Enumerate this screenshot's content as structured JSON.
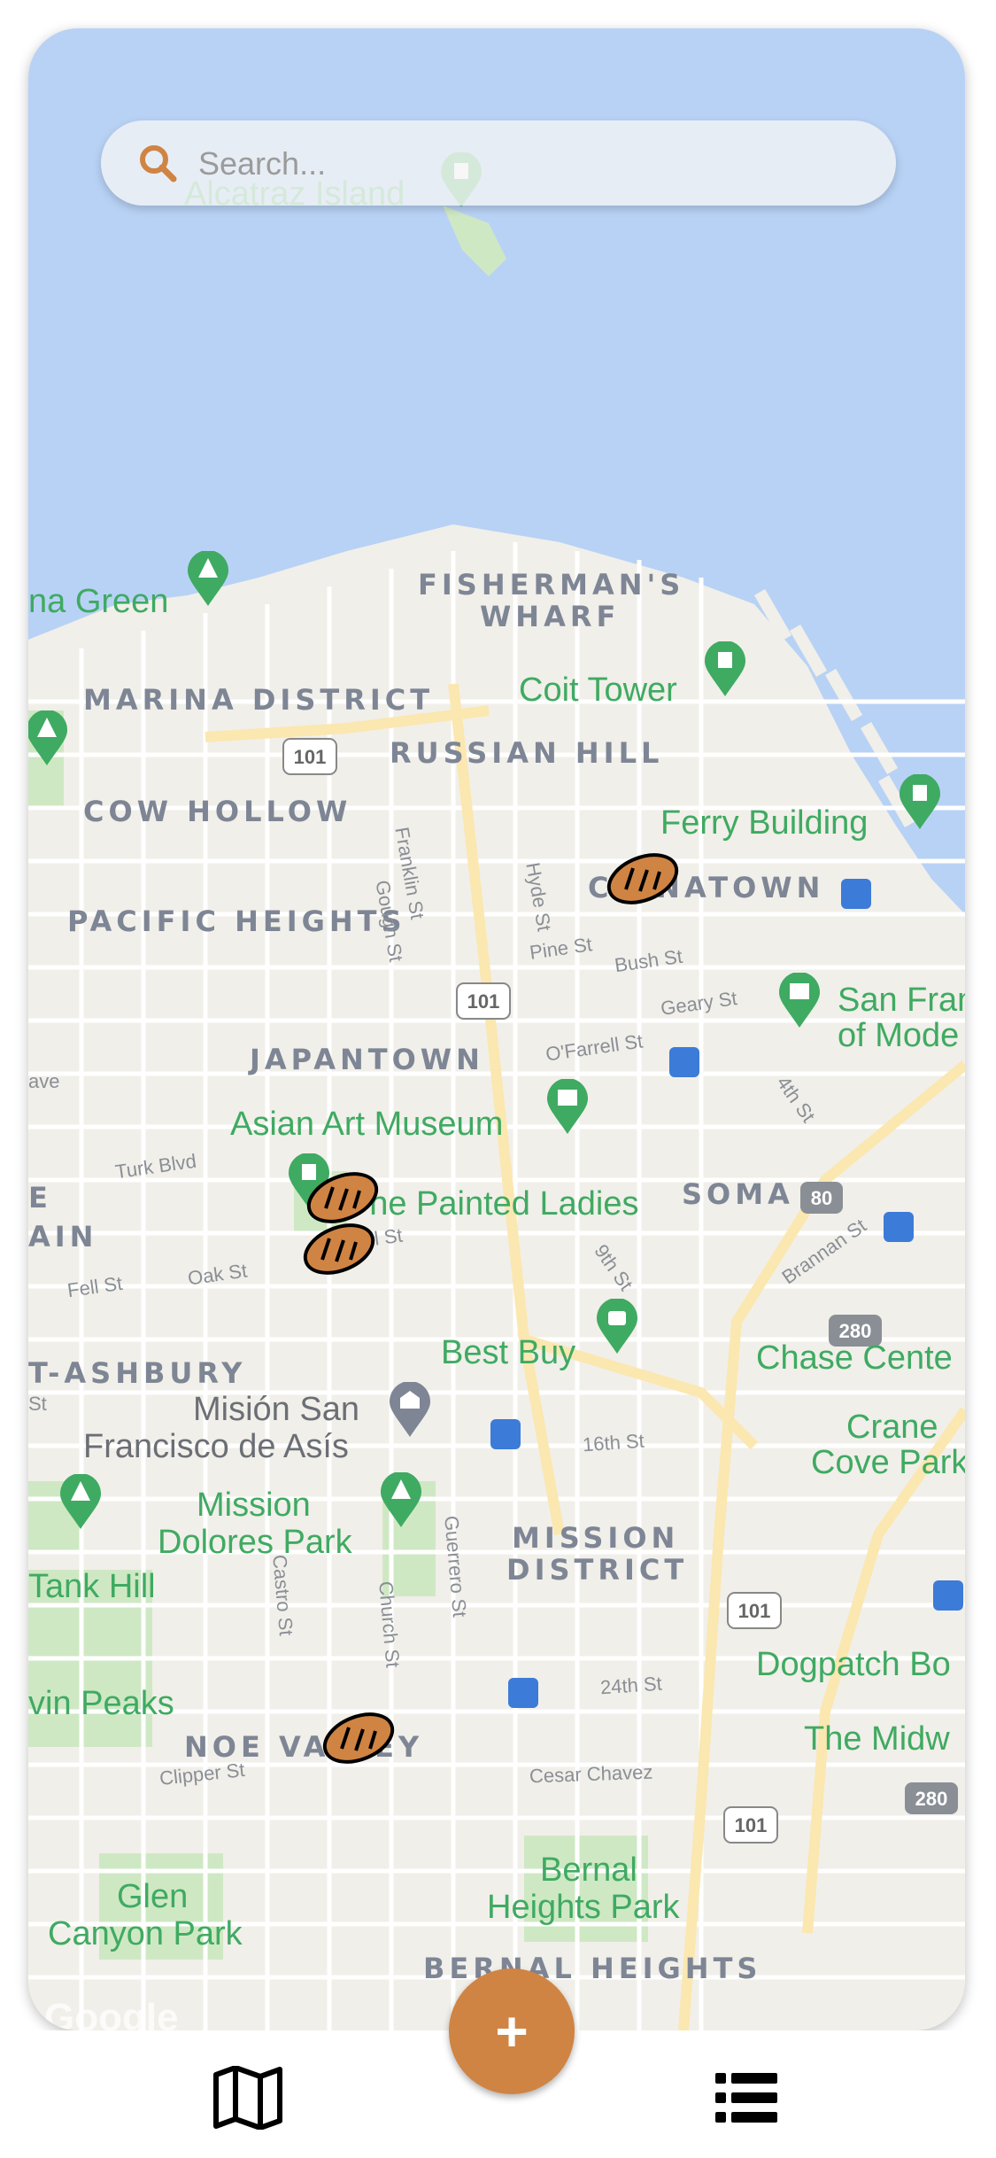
{
  "search": {
    "placeholder": "Search..."
  },
  "map": {
    "districts": {
      "fishermans_wharf": "FISHERMAN'S",
      "fishermans_wharf_2": "WHARF",
      "marina": "MARINA DISTRICT",
      "russian_hill": "RUSSIAN HILL",
      "cow_hollow": "COW HOLLOW",
      "chinatown": "CHINATOWN",
      "pacific_heights": "PACIFIC HEIGHTS",
      "japantown": "JAPANTOWN",
      "soma": "SOMA",
      "western_addition": "AIN",
      "western_addition_e": "E",
      "haight": "T-ASHBURY",
      "mission": "MISSION",
      "mission_2": "DISTRICT",
      "noe_valley": "NOE VALLEY",
      "bernal": "BERNAL HEIGHTS"
    },
    "pois": {
      "alcatraz": "Alcatraz Island",
      "marina_green": "na Green",
      "coit_tower": "Coit Tower",
      "ferry_building": "Ferry Building",
      "sfmoma_1": "San Fran",
      "sfmoma_2": "of Mode",
      "asian_art": "Asian Art Museum",
      "painted_ladies": "The Painted Ladies",
      "best_buy": "Best Buy",
      "chase_center": "Chase Cente",
      "mission_san_1": "Misión San",
      "mission_san_2": "Francisco de Asís",
      "crane_cove_1": "Crane",
      "crane_cove_2": "Cove Park",
      "mission_dolores_1": "Mission",
      "mission_dolores_2": "Dolores Park",
      "tank_hill": "Tank Hill",
      "dogpatch": "Dogpatch Bo",
      "twin_peaks": "vin Peaks",
      "the_midway": "The Midw",
      "glen_canyon_1": "Glen",
      "glen_canyon_2": "Canyon Park",
      "bernal_park_1": "Bernal",
      "bernal_park_2": "Heights Park"
    },
    "streets": {
      "franklin": "Franklin St",
      "gough": "Gough St",
      "hyde": "Hyde St",
      "pine": "Pine St",
      "bush": "Bush St",
      "geary": "Geary St",
      "ofarrell": "O'Farrell St",
      "turk": "Turk Blvd",
      "fourth": "4th St",
      "ninth": "9th St",
      "brannan": "Brannan St",
      "fell": "Fell St",
      "oak": "Oak St",
      "sixteenth": "16th St",
      "guerrero": "Guerrero St",
      "castro": "Castro St",
      "church": "Church St",
      "twentyfourth": "24th St",
      "cesar_chavez": "Cesar Chavez",
      "clipper": "Clipper St",
      "ave": "ave",
      "st": "St",
      "hay": "ll St"
    },
    "shields": {
      "us101": "101",
      "i80": "80",
      "i280": "280"
    },
    "attribution": "Google"
  },
  "fab": {
    "label": "+"
  },
  "nav": {
    "map_icon": "map-icon",
    "list_icon": "list-icon"
  },
  "colors": {
    "water": "#b8d2f5",
    "land": "#f1efe9",
    "accent": "#d08443",
    "park": "#cfe8c4",
    "poi": "#3faa62"
  }
}
